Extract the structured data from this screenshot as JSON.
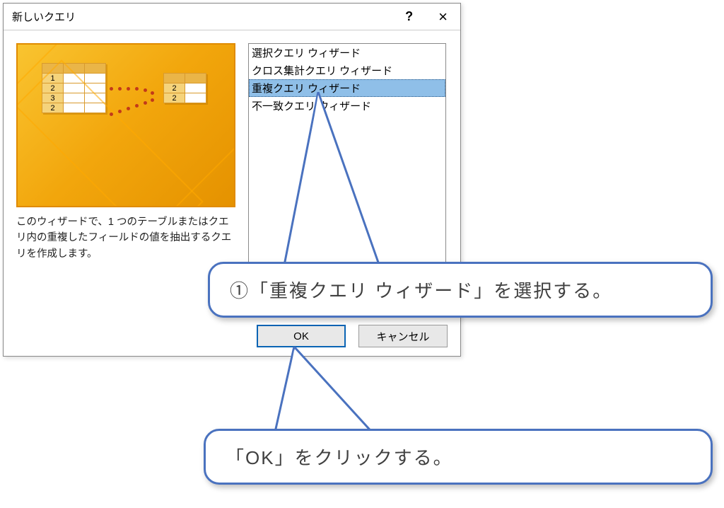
{
  "dialog": {
    "title": "新しいクエリ",
    "help": "?",
    "close": "×",
    "description": "このウィザードで、1 つのテーブルまたはクエリ内の重複したフィールドの値を抽出するクエリを作成します。",
    "list": {
      "items": [
        "選択クエリ ウィザード",
        "クロス集計クエリ ウィザード",
        "重複クエリ ウィザード",
        "不一致クエリ ウィザード"
      ],
      "selected_index": 2
    },
    "buttons": {
      "ok": "OK",
      "cancel": "キャンセル"
    }
  },
  "callouts": {
    "step1": "①「重複クエリ ウィザード」を選択する。",
    "step2": "「OK」をクリックする。"
  },
  "colors": {
    "callout_border": "#4a72bf",
    "selection": "#8fbfe8"
  }
}
